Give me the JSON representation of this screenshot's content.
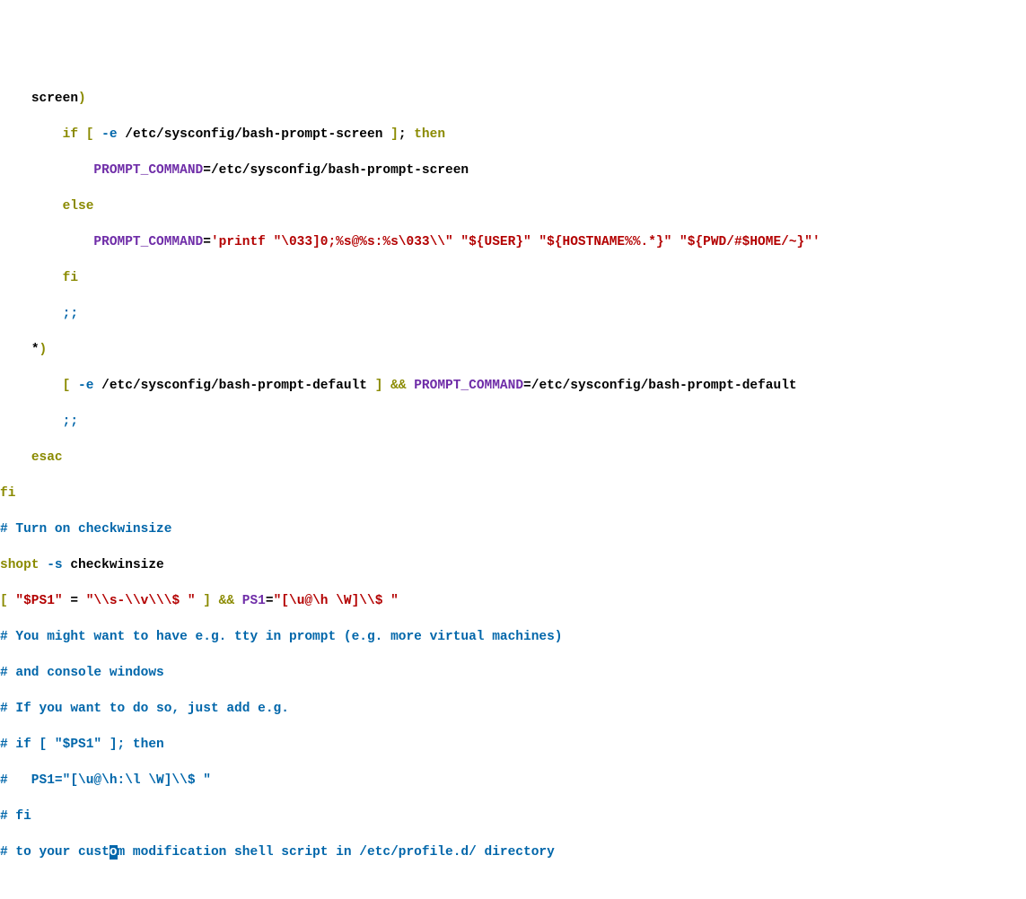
{
  "lines": {
    "l1_ind": "    ",
    "l1_screen": "screen",
    "l1_rp": ")",
    "l2_ind": "        ",
    "l2_if": "if",
    "l2_sp": " ",
    "l2_lb": "[",
    "l2_sp2": " ",
    "l2_flag": "-e",
    "l2_sp3": " ",
    "l2_path": "/etc/sysconfig/bash-prompt-screen",
    "l2_sp4": " ",
    "l2_rb": "]",
    "l2_semi": ";",
    "l2_sp5": " ",
    "l2_then": "then",
    "l3_ind": "            ",
    "l3_pc": "PROMPT_COMMAND",
    "l3_eq": "=",
    "l3_path": "/etc/sysconfig/bash-prompt-screen",
    "l4_ind": "        ",
    "l4_else": "else",
    "l5_ind": "            ",
    "l5_pc": "PROMPT_COMMAND",
    "l5_eq": "=",
    "l5_str": "'printf \"\\033]0;%s@%s:%s\\033\\\\\" \"${USER}\" \"${HOSTNAME%%.*}\" \"${PWD/#$HOME/~}\"'",
    "l6_ind": "        ",
    "l6_fi": "fi",
    "l7_ind": "        ",
    "l7_dsc": ";;",
    "l8_ind": "    ",
    "l8_star": "*",
    "l8_rp": ")",
    "l9_ind": "        ",
    "l9_lb": "[",
    "l9_sp": " ",
    "l9_flag": "-e",
    "l9_sp2": " ",
    "l9_path": "/etc/sysconfig/bash-prompt-default",
    "l9_sp3": " ",
    "l9_rb": "]",
    "l9_sp4": " ",
    "l9_and": "&&",
    "l9_sp5": " ",
    "l9_pc": "PROMPT_COMMAND",
    "l9_eq": "=",
    "l9_path2": "/etc/sysconfig/bash-prompt-default",
    "l10_ind": "        ",
    "l10_dsc": ";;",
    "l11_ind": "    ",
    "l11_esac": "esac",
    "l12": "fi",
    "l13": "# Turn on checkwinsize",
    "l14_shopt": "shopt",
    "l14_sp": " ",
    "l14_flag": "-s",
    "l14_sp2": " ",
    "l14_cw": "checkwinsize",
    "l15_lb": "[",
    "l15_sp": " ",
    "l15_ps1": "\"$PS1\"",
    "l15_sp2": " ",
    "l15_eq": "=",
    "l15_sp3": " ",
    "l15_str": "\"\\\\s-\\\\v\\\\\\$ \"",
    "l15_sp4": " ",
    "l15_rb": "]",
    "l15_sp5": " ",
    "l15_and": "&&",
    "l15_sp6": " ",
    "l15_psvar": "PS1",
    "l15_eq2": "=",
    "l15_str2": "\"[\\u@\\h \\W]\\\\$ \"",
    "l16": "# You might want to have e.g. tty in prompt (e.g. more virtual machines)",
    "l17": "# and console windows",
    "l18": "# If you want to do so, just add e.g.",
    "l19": "# if [ \"$PS1\" ]; then",
    "l20": "#   PS1=\"[\\u@\\h:\\l \\W]\\\\$ \"",
    "l21": "# fi",
    "l22a": "# to your cust",
    "l22b": "o",
    "l22c": "m modification shell script in /etc/profile.d/ directory"
  }
}
